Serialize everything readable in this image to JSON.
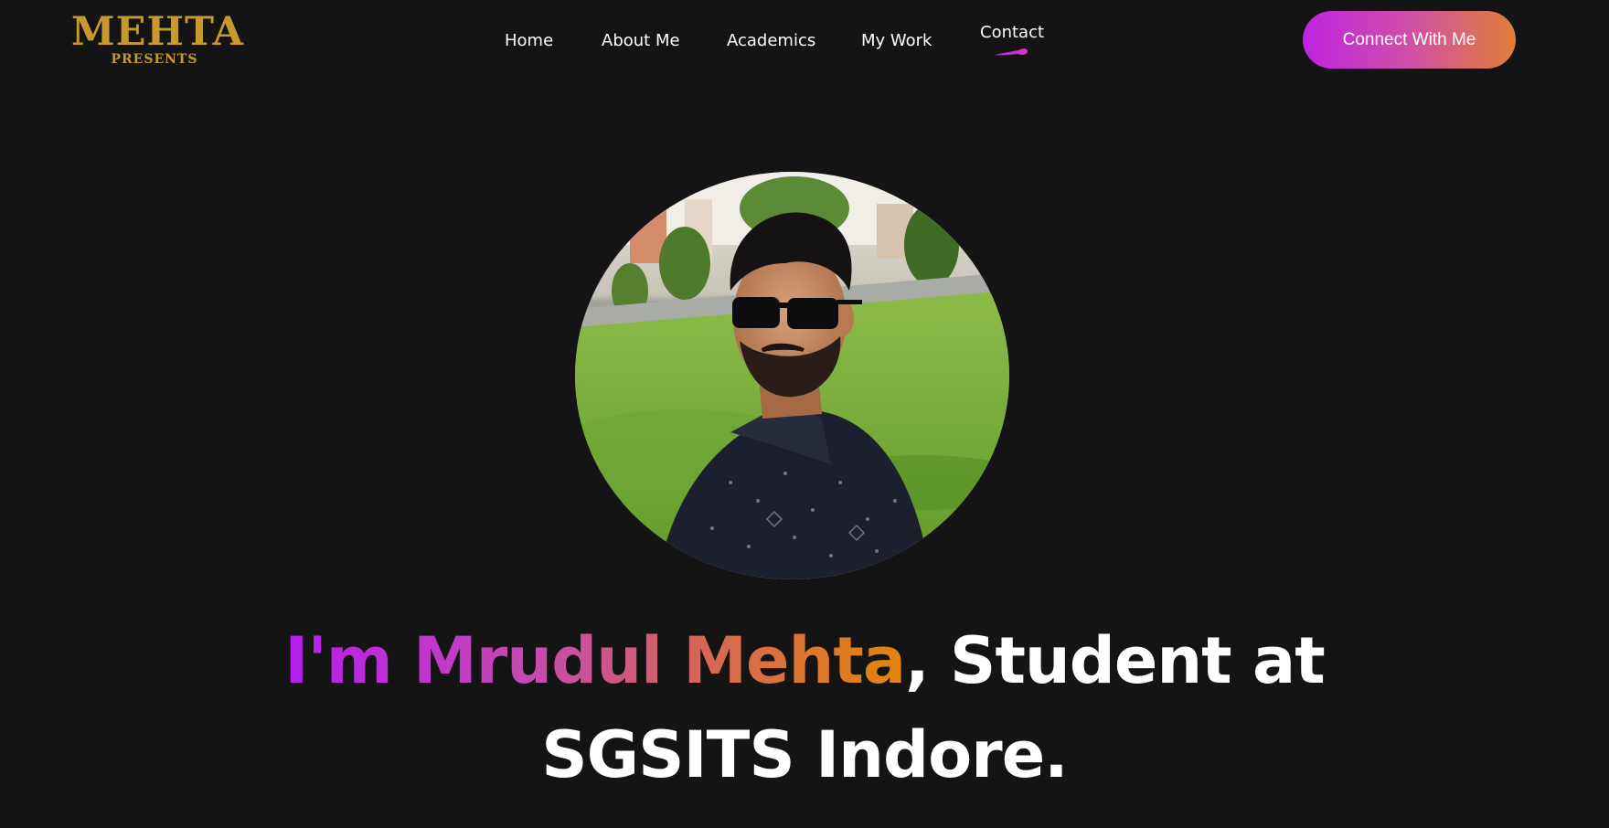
{
  "logo": {
    "main": "MEHTA",
    "sub": "PRESENTS",
    "color": "#c89a2c"
  },
  "nav": {
    "items": [
      {
        "label": "Home"
      },
      {
        "label": "About Me"
      },
      {
        "label": "Academics"
      },
      {
        "label": "My Work"
      },
      {
        "label": "Contact",
        "active": true
      }
    ]
  },
  "cta": {
    "label": "Connect With Me"
  },
  "hero": {
    "photo_icon": "profile-photo",
    "headline_highlight": "I'm Mrudul Mehta",
    "headline_line1_rest": ", Student at",
    "headline_line2": "SGSITS Indore."
  },
  "colors": {
    "background": "#151414",
    "gradient_start": "#b51df0",
    "gradient_end": "#e2850f",
    "text": "#ffffff"
  }
}
